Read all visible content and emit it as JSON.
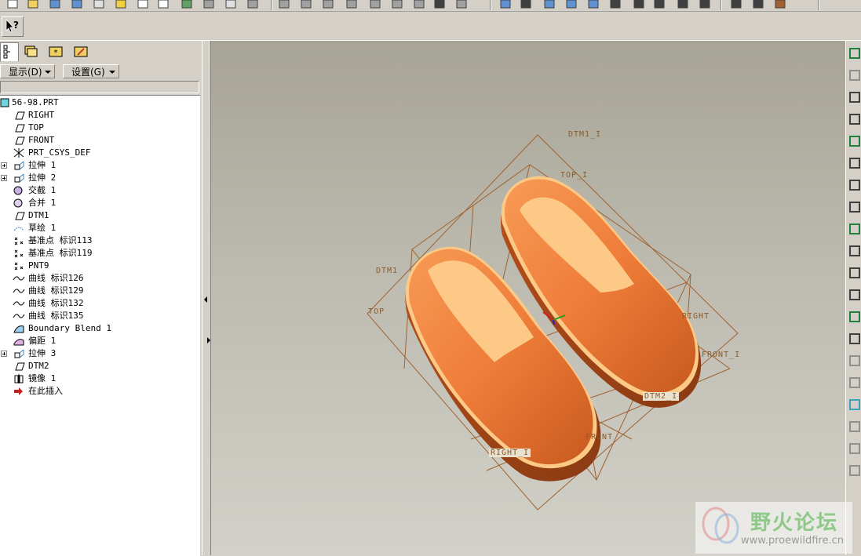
{
  "toolbar": {
    "icons": [
      "new-icon",
      "open-icon",
      "save-icon",
      "save-copy-icon",
      "tasks-icon",
      "smiley-icon",
      "close-window-icon",
      "edit-icon",
      "pencil-icon",
      "print-icon",
      "mail-icon",
      "link-icon",
      "undo-icon",
      "redo-icon",
      "cut-icon",
      "copy-icon",
      "paste-icon",
      "paste-special-icon",
      "list-icon",
      "binoculars-icon",
      "select-box-icon",
      "repaint-icon",
      "spin-icon",
      "zoom-in-icon",
      "zoom-out-icon",
      "zoom-fit-icon",
      "orient-icon",
      "saved-views-icon",
      "layers-icon",
      "shading-icon",
      "wireframe-icon",
      "hidden-line-icon",
      "no-hidden-icon",
      "datum-icon"
    ]
  },
  "help_button": {
    "icon": "whats-this-help-icon"
  },
  "left_panel": {
    "tabs": [
      "model-tree-icon",
      "folder-browser-icon",
      "favorites-icon",
      "connections-icon"
    ],
    "menus": {
      "display_label": "显示(D)",
      "settings_label": "设置(G)"
    },
    "tree": {
      "root": "56-98.PRT",
      "items": [
        {
          "label": "RIGHT",
          "icon": "datum-plane-icon",
          "expandable": false
        },
        {
          "label": "TOP",
          "icon": "datum-plane-icon",
          "expandable": false
        },
        {
          "label": "FRONT",
          "icon": "datum-plane-icon",
          "expandable": false
        },
        {
          "label": "PRT_CSYS_DEF",
          "icon": "coordinate-system-icon",
          "expandable": false
        },
        {
          "label": "拉伸 1",
          "icon": "extrude-icon",
          "expandable": true
        },
        {
          "label": "拉伸 2",
          "icon": "extrude-icon",
          "expandable": true
        },
        {
          "label": "交截 1",
          "icon": "intersect-icon",
          "expandable": false
        },
        {
          "label": "合并 1",
          "icon": "merge-icon",
          "expandable": false
        },
        {
          "label": "DTM1",
          "icon": "datum-plane-icon",
          "expandable": false
        },
        {
          "label": "草绘 1",
          "icon": "sketch-icon",
          "expandable": false
        },
        {
          "label": "基准点 标识113",
          "icon": "datum-point-icon",
          "expandable": false
        },
        {
          "label": "基准点 标识119",
          "icon": "datum-point-icon",
          "expandable": false
        },
        {
          "label": "PNT9",
          "icon": "datum-point-icon",
          "expandable": false
        },
        {
          "label": "曲线 标识126",
          "icon": "curve-icon",
          "expandable": false
        },
        {
          "label": "曲线 标识129",
          "icon": "curve-icon",
          "expandable": false
        },
        {
          "label": "曲线 标识132",
          "icon": "curve-icon",
          "expandable": false
        },
        {
          "label": "曲线 标识135",
          "icon": "curve-icon",
          "expandable": false
        },
        {
          "label": "Boundary Blend 1",
          "icon": "boundary-blend-icon",
          "expandable": false
        },
        {
          "label": "偏距 1",
          "icon": "offset-icon",
          "expandable": false
        },
        {
          "label": "拉伸 3",
          "icon": "extrude-icon",
          "expandable": true
        },
        {
          "label": "DTM2",
          "icon": "datum-plane-icon",
          "expandable": false
        },
        {
          "label": "镜像 1",
          "icon": "mirror-icon",
          "expandable": false
        },
        {
          "label": "在此插入",
          "icon": "insert-here-arrow-icon",
          "expandable": false
        }
      ]
    }
  },
  "viewport": {
    "datum_labels": {
      "dtm1_i": "DTM1_I",
      "top_i": "TOP_I",
      "dtm1": "DTM1",
      "top": "TOP",
      "right": "RIGHT",
      "front_i": "FRONT_I",
      "dtm2_i": "DTM2_I",
      "front": "FRONT",
      "right_i": "RIGHT_I"
    },
    "colors": {
      "shoe_body": "#f0843e",
      "shoe_insole": "#fdc986",
      "datum_lines": "#a0622f"
    }
  },
  "right_toolbar": {
    "icons": [
      "datum-plane-tool-icon",
      "datum-axis-tool-icon",
      "datum-curve-tool-icon",
      "datum-point-tool-icon",
      "csys-tool-icon",
      "analysis-icon",
      "sketch-tool-icon",
      "hole-tool-icon",
      "shell-tool-icon",
      "rib-tool-icon",
      "draft-tool-icon",
      "round-tool-icon",
      "chamfer-tool-icon",
      "extrude-tool-icon",
      "revolve-tool-icon",
      "sweep-tool-icon",
      "blend-tool-icon",
      "style-tool-icon",
      "mirror-tool-icon",
      "merge-tool-icon"
    ]
  },
  "watermark": {
    "text": "野火论坛",
    "url": "www.proewildfire.cn"
  }
}
